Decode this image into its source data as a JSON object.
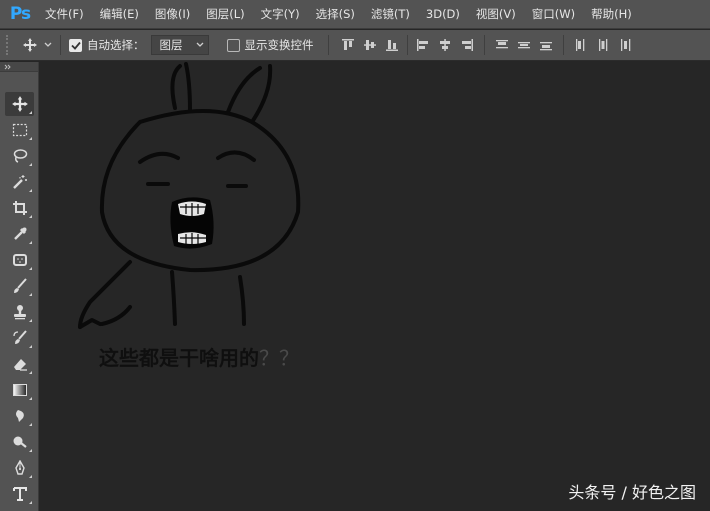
{
  "app": {
    "logo_text": "Ps"
  },
  "menu": [
    "文件(F)",
    "编辑(E)",
    "图像(I)",
    "图层(L)",
    "文字(Y)",
    "选择(S)",
    "滤镜(T)",
    "3D(D)",
    "视图(V)",
    "窗口(W)",
    "帮助(H)"
  ],
  "options": {
    "auto_select_label": "自动选择：",
    "auto_select_checked": true,
    "layer_select_value": "图层",
    "show_transform_label": "显示变换控件",
    "show_transform_checked": false
  },
  "canvas": {
    "caption_main": "这些都是干啥用的",
    "caption_marks": "？？",
    "watermark": "头条号 / 好色之图"
  },
  "icons": {
    "move": "move-icon",
    "marquee": "rect-marquee-icon",
    "lasso": "lasso-icon",
    "magic_wand": "magic-wand-icon",
    "crop": "crop-icon",
    "eyedropper": "eyedropper-icon",
    "healing": "healing-brush-icon",
    "brush": "brush-icon",
    "stamp": "clone-stamp-icon",
    "history_brush": "history-brush-icon",
    "eraser": "eraser-icon",
    "gradient": "gradient-icon",
    "blur": "blur-icon",
    "dodge": "dodge-icon",
    "pen": "pen-icon",
    "type": "type-icon"
  },
  "colors": {
    "ui_panel": "#535353",
    "canvas_bg": "#262626",
    "ps_blue": "#31a8ff"
  }
}
